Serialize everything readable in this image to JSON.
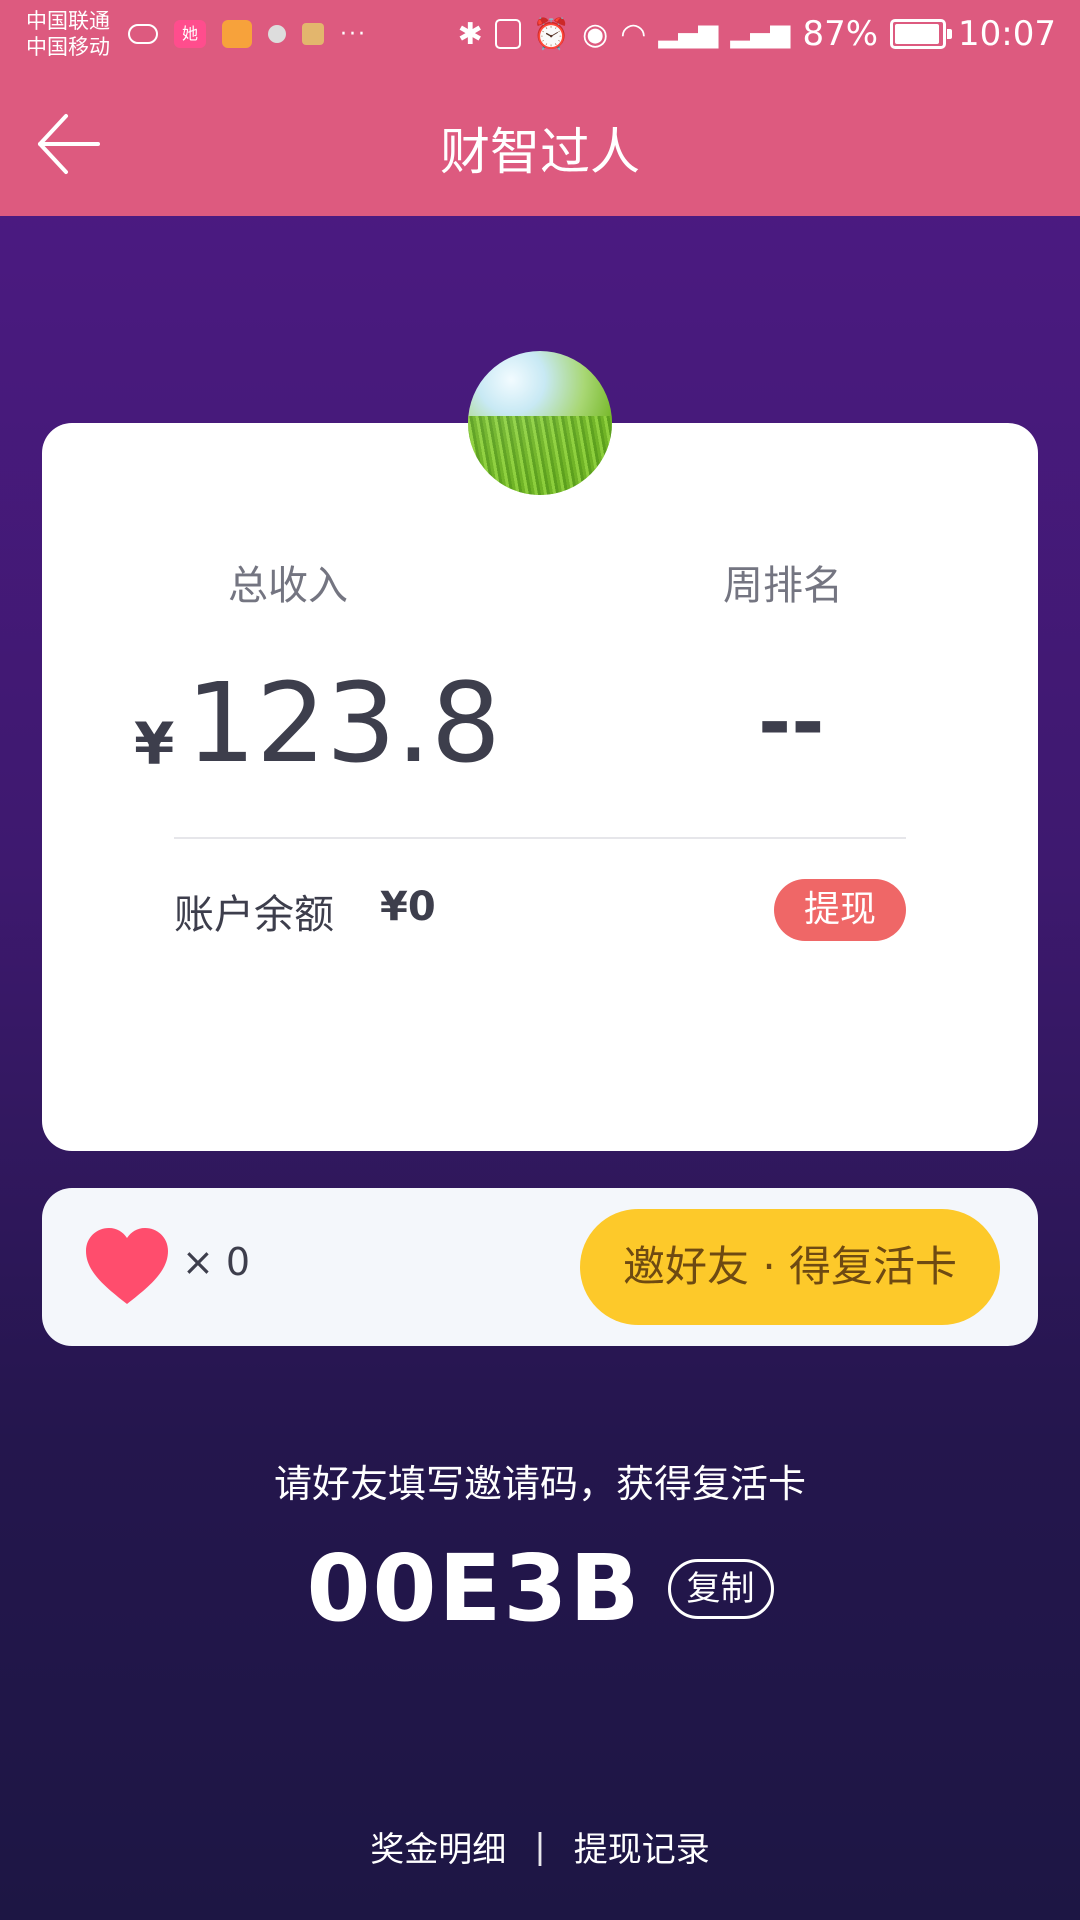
{
  "status_bar": {
    "carrier_1": "中国联通",
    "carrier_2": "中国移动",
    "battery": "87%",
    "time": "10:07",
    "app_icon_text": "她"
  },
  "header": {
    "title": "财智过人",
    "back_icon": "arrow-left-icon"
  },
  "stats": {
    "total_income_label": "总收入",
    "currency_symbol": "¥",
    "total_income_value": "123.8",
    "weekly_rank_label": "周排名",
    "weekly_rank_value": "--"
  },
  "balance": {
    "label": "账户余额",
    "value": "¥0",
    "withdraw_button": "提现"
  },
  "revive": {
    "heart_icon": "heart-icon",
    "count": "× 0",
    "invite_button": "邀好友 · 得复活卡"
  },
  "invite": {
    "hint": "请好友填写邀请码，获得复活卡",
    "code": "00E3B",
    "copy_button": "复制"
  },
  "footer": {
    "bonus_detail": "奖金明细",
    "separator": "|",
    "withdraw_record": "提现记录"
  },
  "colors": {
    "header_bg": "#dd5a7f",
    "bg_top": "#4f1a86",
    "bg_bottom": "#1d1644",
    "withdraw_btn": "#ef6767",
    "invite_btn": "#fdc92a",
    "heart": "#ff4d6d"
  }
}
